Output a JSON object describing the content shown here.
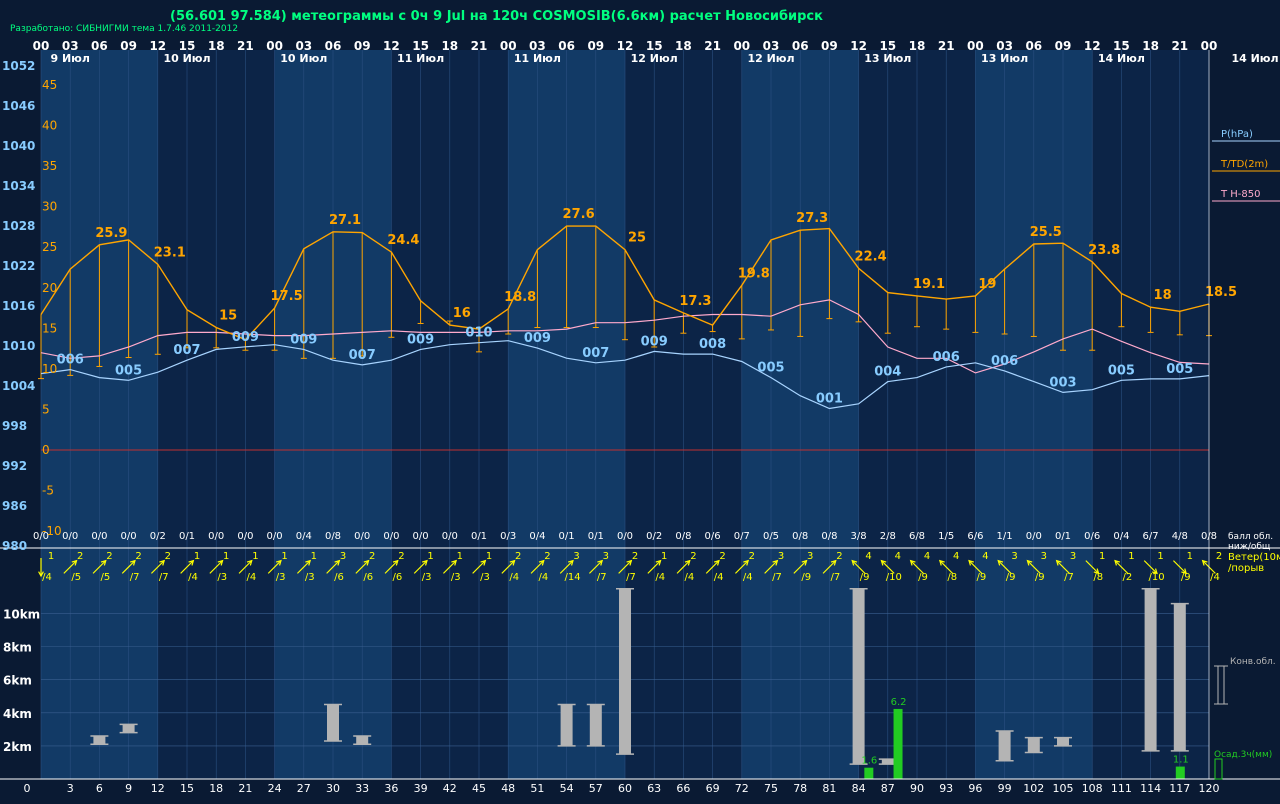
{
  "header": {
    "title": "(56.601 97.584) метеограммы с  0ч 9 Jul на 120ч COSMOSIB(6.6км) расчет Новосибирск",
    "credit": "Разработано: СИБНИГМИ тема 1.7.46 2011-2012"
  },
  "colors": {
    "background": "#0a1a33",
    "band_light": "#123a66",
    "band_dark": "#0c2447",
    "pressure": "#a8d4ff",
    "temperature": "#ffa500",
    "t850": "#ffaacc",
    "zero_line": "#c03030",
    "wind": "#ffff00",
    "cloud": "#b4b4b4",
    "precip": "#22cc22",
    "axis_text": "#ffffff",
    "pressure_label": "#88ccff",
    "temp_label": "#ffa500"
  },
  "chart_data": {
    "type": "meteogram",
    "x_hours": [
      0,
      3,
      6,
      9,
      12,
      15,
      18,
      21,
      24,
      27,
      30,
      33,
      36,
      39,
      42,
      45,
      48,
      51,
      54,
      57,
      60,
      63,
      66,
      69,
      72,
      75,
      78,
      81,
      84,
      87,
      90,
      93,
      96,
      99,
      102,
      105,
      108,
      111,
      114,
      117,
      120
    ],
    "hour_ticks": [
      "00",
      "03",
      "06",
      "09",
      "12",
      "15",
      "18",
      "21",
      "00",
      "03",
      "06",
      "09",
      "12",
      "15",
      "18",
      "21",
      "00",
      "03",
      "06",
      "09",
      "12",
      "15",
      "18",
      "21",
      "00",
      "03",
      "06",
      "09",
      "12",
      "15",
      "18",
      "21",
      "00",
      "03",
      "06",
      "09",
      "12",
      "15",
      "18",
      "21",
      "00"
    ],
    "date_labels": [
      {
        "hour": 3,
        "text": "9 Июл"
      },
      {
        "hour": 15,
        "text": "10 Июл"
      },
      {
        "hour": 27,
        "text": "10 Июл"
      },
      {
        "hour": 39,
        "text": "11 Июл"
      },
      {
        "hour": 51,
        "text": "11 Июл"
      },
      {
        "hour": 63,
        "text": "12 Июл"
      },
      {
        "hour": 75,
        "text": "12 Июл"
      },
      {
        "hour": 87,
        "text": "13 Июл"
      },
      {
        "hour": 99,
        "text": "13 Июл"
      },
      {
        "hour": 111,
        "text": "14 Июл"
      },
      {
        "hour": 123,
        "text": "14 Июл"
      }
    ],
    "pressure_axis": {
      "ticks": [
        1052,
        1046,
        1040,
        1034,
        1028,
        1022,
        1016,
        1010,
        1004,
        998,
        992,
        986,
        980
      ],
      "ylim": [
        980,
        1052
      ]
    },
    "temp_axis": {
      "ticks": [
        45,
        40,
        35,
        30,
        25,
        20,
        15,
        10,
        5,
        0,
        -5,
        -10
      ],
      "ylim": [
        -12,
        47
      ]
    },
    "pressure": [
      1006.0,
      1006.6,
      1005.4,
      1005.0,
      1006.2,
      1008.0,
      1009.6,
      1010.0,
      1010.3,
      1009.6,
      1008.0,
      1007.3,
      1008.0,
      1009.6,
      1010.3,
      1010.6,
      1010.9,
      1009.8,
      1008.3,
      1007.6,
      1008.0,
      1009.3,
      1008.9,
      1008.9,
      1007.8,
      1005.4,
      1002.7,
      1000.8,
      1001.5,
      1004.8,
      1005.4,
      1007.0,
      1007.6,
      1006.4,
      1004.8,
      1003.2,
      1003.6,
      1005.0,
      1005.2,
      1005.2,
      1005.7
    ],
    "temperature": [
      16.7,
      22.3,
      25.3,
      25.9,
      22.9,
      17.3,
      15.1,
      13.6,
      17.5,
      24.8,
      26.9,
      26.8,
      24.4,
      18.4,
      15.4,
      14.9,
      17.4,
      24.7,
      27.6,
      27.6,
      24.7,
      18.5,
      16.9,
      15.4,
      20.3,
      25.9,
      27.1,
      27.3,
      22.4,
      19.4,
      19.0,
      18.6,
      19.0,
      22.3,
      25.4,
      25.5,
      23.2,
      19.3,
      17.6,
      17.1,
      18.0
    ],
    "dewpoint": [
      8.8,
      9.2,
      10.3,
      11.4,
      11.8,
      12.6,
      12.6,
      12.3,
      12.3,
      11.3,
      11.3,
      11.6,
      13.9,
      15.6,
      15.9,
      12.1,
      14.3,
      15.1,
      15.1,
      15.1,
      13.6,
      12.7,
      14.4,
      14.6,
      13.7,
      14.8,
      14.0,
      16.2,
      15.8,
      14.4,
      15.2,
      14.9,
      14.5,
      14.3,
      14.0,
      12.3,
      12.3,
      15.2,
      14.5,
      14.2,
      14.1
    ],
    "t850": [
      12.0,
      11.3,
      11.6,
      12.7,
      14.1,
      14.5,
      14.5,
      14.3,
      14.1,
      14.1,
      14.3,
      14.5,
      14.7,
      14.5,
      14.5,
      14.5,
      14.7,
      14.7,
      14.9,
      15.7,
      15.7,
      16.0,
      16.5,
      16.7,
      16.7,
      16.5,
      17.9,
      18.5,
      16.7,
      12.7,
      11.3,
      11.3,
      9.5,
      10.6,
      12.1,
      13.7,
      14.9,
      13.4,
      12.0,
      10.8,
      10.6
    ],
    "pressure_labels": [
      {
        "hour": 3,
        "value": "006"
      },
      {
        "hour": 9,
        "value": "005"
      },
      {
        "hour": 15,
        "value": "007"
      },
      {
        "hour": 21,
        "value": "009"
      },
      {
        "hour": 27,
        "value": "009"
      },
      {
        "hour": 33,
        "value": "007"
      },
      {
        "hour": 39,
        "value": "009"
      },
      {
        "hour": 45,
        "value": "010"
      },
      {
        "hour": 51,
        "value": "009"
      },
      {
        "hour": 57,
        "value": "007"
      },
      {
        "hour": 63,
        "value": "009"
      },
      {
        "hour": 69,
        "value": "008"
      },
      {
        "hour": 75,
        "value": "005"
      },
      {
        "hour": 81,
        "value": "001"
      },
      {
        "hour": 87,
        "value": "004"
      },
      {
        "hour": 93,
        "value": "006"
      },
      {
        "hour": 99,
        "value": "006"
      },
      {
        "hour": 105,
        "value": "003"
      },
      {
        "hour": 111,
        "value": "005"
      },
      {
        "hour": 117,
        "value": "005"
      }
    ],
    "temp_labels": [
      {
        "hour": 6,
        "value": "25.9"
      },
      {
        "hour": 12,
        "value": "23.1"
      },
      {
        "hour": 18,
        "value": "15"
      },
      {
        "hour": 24,
        "value": "17.5"
      },
      {
        "hour": 30,
        "value": "27.1"
      },
      {
        "hour": 36,
        "value": "24.4"
      },
      {
        "hour": 42,
        "value": "16"
      },
      {
        "hour": 48,
        "value": "18.8"
      },
      {
        "hour": 54,
        "value": "27.6"
      },
      {
        "hour": 60,
        "value": "25"
      },
      {
        "hour": 66,
        "value": "17.3"
      },
      {
        "hour": 72,
        "value": "19.8"
      },
      {
        "hour": 78,
        "value": "27.3"
      },
      {
        "hour": 84,
        "value": "22.4"
      },
      {
        "hour": 90,
        "value": "19.1"
      },
      {
        "hour": 96,
        "value": "19"
      },
      {
        "hour": 102,
        "value": "25.5"
      },
      {
        "hour": 108,
        "value": "23.8"
      },
      {
        "hour": 114,
        "value": "18"
      },
      {
        "hour": 120,
        "value": "18.5"
      }
    ],
    "cloud_oktas": [
      "0/0",
      "0/0",
      "0/0",
      "0/0",
      "0/2",
      "0/1",
      "0/0",
      "0/0",
      "0/0",
      "0/4",
      "0/8",
      "0/0",
      "0/0",
      "0/0",
      "0/0",
      "0/1",
      "0/3",
      "0/4",
      "0/1",
      "0/1",
      "0/0",
      "0/2",
      "0/8",
      "0/6",
      "0/7",
      "0/5",
      "0/8",
      "0/8",
      "3/8",
      "2/8",
      "6/8",
      "1/5",
      "6/6",
      "1/1",
      "0/0",
      "0/1",
      "0/6",
      "0/4",
      "6/7",
      "4/8",
      "0/8"
    ],
    "wind": [
      {
        "speed": "1",
        "gust": "/4",
        "dir": 90
      },
      {
        "speed": "2",
        "gust": "/5",
        "dir": 225
      },
      {
        "speed": "2",
        "gust": "/5",
        "dir": 225
      },
      {
        "speed": "2",
        "gust": "/7",
        "dir": 225
      },
      {
        "speed": "2",
        "gust": "/7",
        "dir": 225
      },
      {
        "speed": "1",
        "gust": "/4",
        "dir": 225
      },
      {
        "speed": "1",
        "gust": "/3",
        "dir": 225
      },
      {
        "speed": "1",
        "gust": "/4",
        "dir": 225
      },
      {
        "speed": "1",
        "gust": "/3",
        "dir": 225
      },
      {
        "speed": "1",
        "gust": "/3",
        "dir": 225
      },
      {
        "speed": "3",
        "gust": "/6",
        "dir": 225
      },
      {
        "speed": "2",
        "gust": "/6",
        "dir": 225
      },
      {
        "speed": "2",
        "gust": "/6",
        "dir": 225
      },
      {
        "speed": "1",
        "gust": "/3",
        "dir": 225
      },
      {
        "speed": "1",
        "gust": "/3",
        "dir": 225
      },
      {
        "speed": "1",
        "gust": "/3",
        "dir": 225
      },
      {
        "speed": "2",
        "gust": "/4",
        "dir": 225
      },
      {
        "speed": "2",
        "gust": "/4",
        "dir": 225
      },
      {
        "speed": "3",
        "gust": "/14",
        "dir": 225
      },
      {
        "speed": "3",
        "gust": "/7",
        "dir": 225
      },
      {
        "speed": "2",
        "gust": "/7",
        "dir": 225
      },
      {
        "speed": "1",
        "gust": "/4",
        "dir": 225
      },
      {
        "speed": "2",
        "gust": "/4",
        "dir": 225
      },
      {
        "speed": "2",
        "gust": "/4",
        "dir": 225
      },
      {
        "speed": "2",
        "gust": "/4",
        "dir": 225
      },
      {
        "speed": "3",
        "gust": "/7",
        "dir": 225
      },
      {
        "speed": "3",
        "gust": "/9",
        "dir": 225
      },
      {
        "speed": "2",
        "gust": "/7",
        "dir": 225
      },
      {
        "speed": "4",
        "gust": "/9",
        "dir": 315
      },
      {
        "speed": "4",
        "gust": "/10",
        "dir": 315
      },
      {
        "speed": "4",
        "gust": "/9",
        "dir": 315
      },
      {
        "speed": "4",
        "gust": "/8",
        "dir": 315
      },
      {
        "speed": "4",
        "gust": "/9",
        "dir": 315
      },
      {
        "speed": "3",
        "gust": "/9",
        "dir": 315
      },
      {
        "speed": "3",
        "gust": "/9",
        "dir": 315
      },
      {
        "speed": "3",
        "gust": "/7",
        "dir": 315
      },
      {
        "speed": "1",
        "gust": "/8",
        "dir": 135
      },
      {
        "speed": "1",
        "gust": "/2",
        "dir": 315
      },
      {
        "speed": "1",
        "gust": "/10",
        "dir": 135
      },
      {
        "speed": "1",
        "gust": "/9",
        "dir": 135
      },
      {
        "speed": "2",
        "gust": "/4",
        "dir": 315
      }
    ],
    "height_axis": {
      "ticks": [
        "10km",
        "8km",
        "6km",
        "4km",
        "2km"
      ],
      "values_km": [
        10,
        8,
        6,
        4,
        2
      ],
      "ylim": [
        0,
        11.5
      ]
    },
    "convective_clouds": [
      {
        "hour": 6,
        "base": 2.1,
        "top": 2.6
      },
      {
        "hour": 9,
        "base": 2.8,
        "top": 3.3
      },
      {
        "hour": 30,
        "base": 2.3,
        "top": 4.5
      },
      {
        "hour": 33,
        "base": 2.1,
        "top": 2.6
      },
      {
        "hour": 54,
        "base": 2.0,
        "top": 4.5
      },
      {
        "hour": 57,
        "base": 2.0,
        "top": 4.5
      },
      {
        "hour": 60,
        "base": 1.5,
        "top": 11.5
      },
      {
        "hour": 84,
        "base": 0.9,
        "top": 11.5
      },
      {
        "hour": 87,
        "base": 0.9,
        "top": 1.2
      },
      {
        "hour": 99,
        "base": 1.1,
        "top": 2.9
      },
      {
        "hour": 102,
        "base": 1.6,
        "top": 2.5
      },
      {
        "hour": 105,
        "base": 2.0,
        "top": 2.5
      },
      {
        "hour": 114,
        "base": 1.7,
        "top": 11.5
      },
      {
        "hour": 117,
        "base": 1.7,
        "top": 10.6
      }
    ],
    "precipitation": [
      {
        "hour": 85,
        "mm": 1.0,
        "label": "1.6"
      },
      {
        "hour": 88,
        "mm": 6.2,
        "label": "6.2"
      },
      {
        "hour": 117,
        "mm": 1.1,
        "label": "1.1"
      }
    ],
    "bottom_hours": [
      "0",
      "3",
      "6",
      "9",
      "12",
      "15",
      "18",
      "21",
      "24",
      "27",
      "30",
      "33",
      "36",
      "39",
      "42",
      "45",
      "48",
      "51",
      "54",
      "57",
      "60",
      "63",
      "66",
      "69",
      "72",
      "75",
      "78",
      "81",
      "84",
      "87",
      "90",
      "93",
      "96",
      "99",
      "102",
      "105",
      "108",
      "111",
      "114",
      "117",
      "120"
    ],
    "legend": {
      "pressure": "P(hPa)",
      "temp": "T/TD(2m)",
      "t850": "T H-850",
      "cloud_low": "балл обл.",
      "cloud_total": "ниж/общ",
      "wind_line1": "Ветер(10м",
      "wind_line2": "/порыв",
      "convective": "Конв.обл.",
      "precip": "Осад.3ч(мм)"
    }
  }
}
